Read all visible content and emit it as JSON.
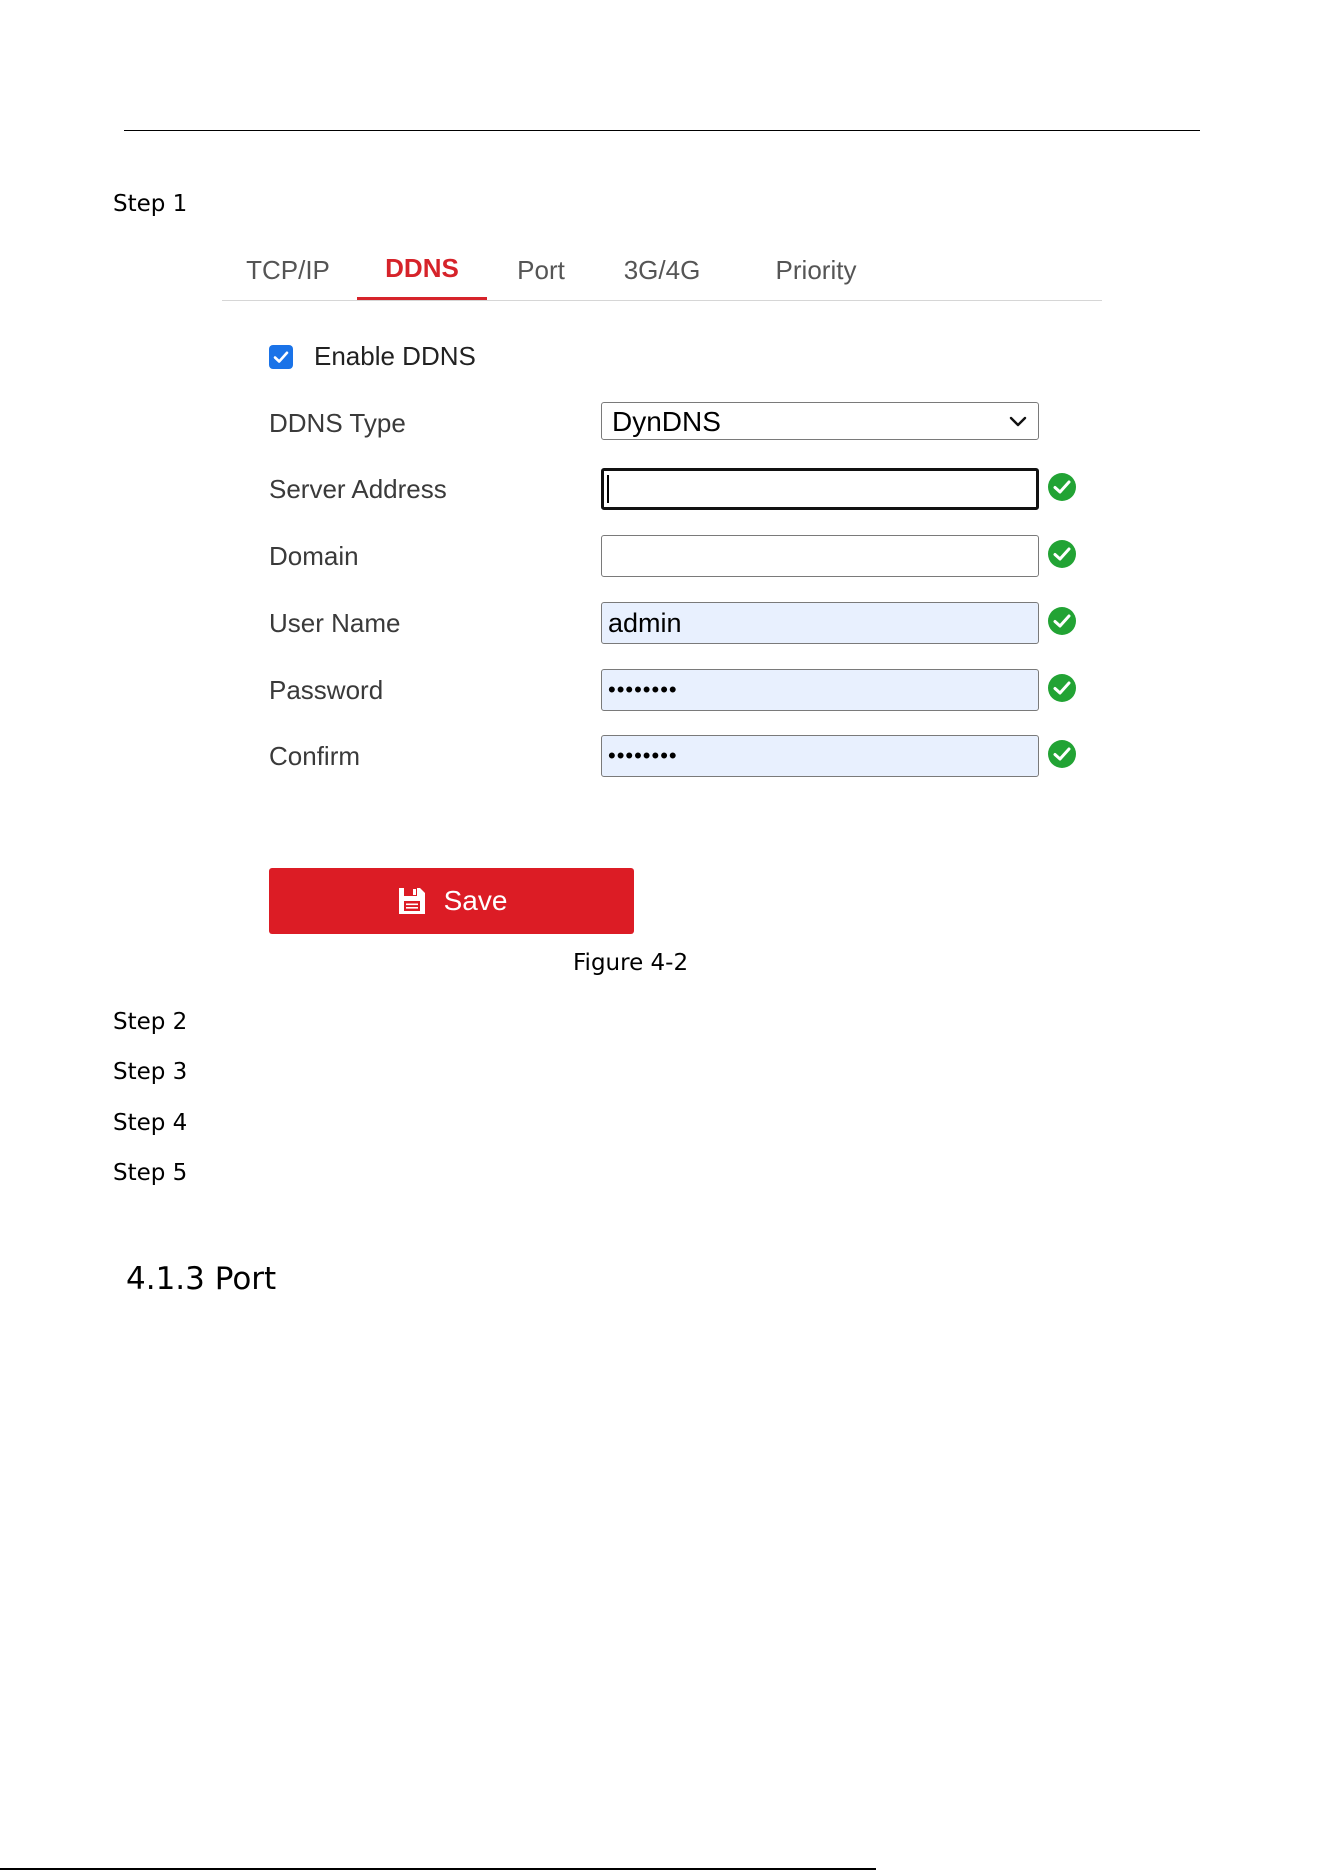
{
  "steps": [
    "Step 1",
    "Step 2",
    "Step 3",
    "Step 4",
    "Step 5"
  ],
  "tabs": [
    "TCP/IP",
    "DDNS",
    "Port",
    "3G/4G",
    "Priority"
  ],
  "active_tab": "DDNS",
  "form": {
    "enable_label": "Enable DDNS",
    "enable_checked": true,
    "ddns_type_label": "DDNS Type",
    "ddns_type_value": "DynDNS",
    "server_address_label": "Server Address",
    "server_address_value": "",
    "domain_label": "Domain",
    "domain_value": "",
    "user_name_label": "User Name",
    "user_name_value": "admin",
    "password_label": "Password",
    "password_value": "••••••••",
    "confirm_label": "Confirm",
    "confirm_value": "••••••••",
    "save_label": "Save"
  },
  "caption": "Figure 4-2",
  "heading": "4.1.3 Port",
  "colors": {
    "accent_red": "#dc1c25",
    "tab_active": "#d6232a",
    "checkbox_blue": "#1a73e8",
    "valid_green": "#22a334",
    "autofill_bg": "#e8f0fe"
  },
  "icons": [
    "chevron-down-icon",
    "check-circle-icon",
    "save-icon",
    "checkmark-icon"
  ]
}
